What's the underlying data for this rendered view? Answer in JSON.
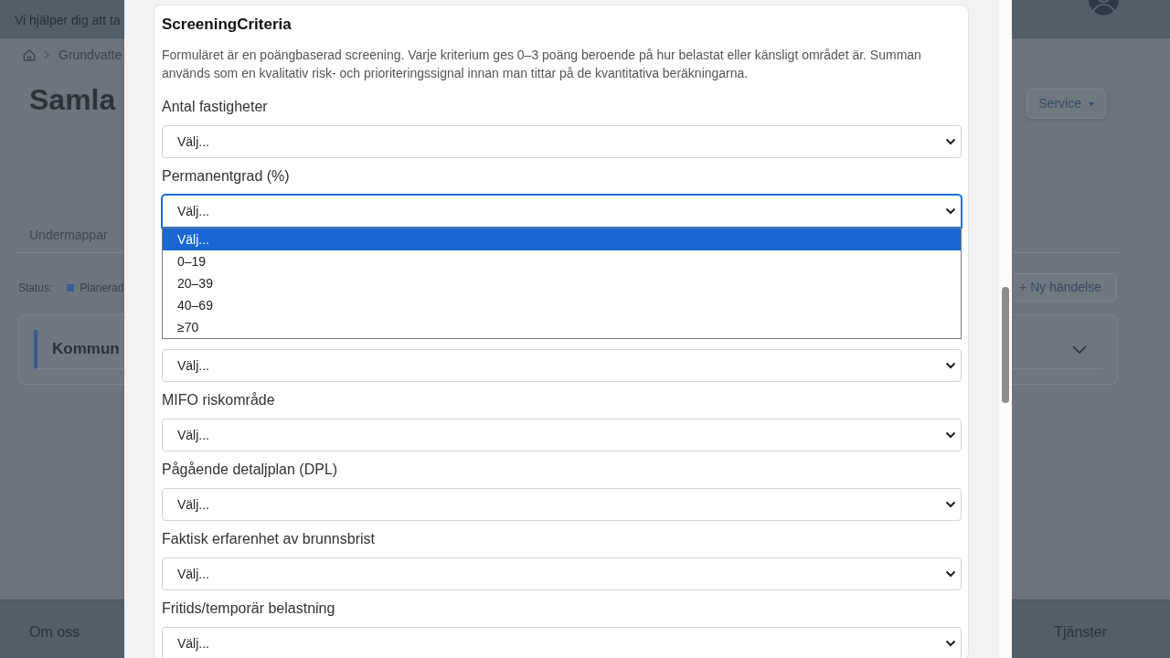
{
  "page": {
    "header": {
      "tagline": "Vi hjälper dig att ta"
    },
    "breadcrumb": {
      "items": [
        "Grundvatte"
      ]
    },
    "title": "Samla",
    "service_button": {
      "label": "Service"
    },
    "tabs": [
      {
        "label": "Undermappar",
        "selected": false
      }
    ],
    "status_bar": {
      "label": "Status:",
      "legend": [
        {
          "label": "Planerad",
          "color": "#3b5b98"
        }
      ]
    },
    "new_event_button": {
      "label": "+ Ny händelse"
    },
    "cards": [
      {
        "title": "Kommun",
        "expanded": false
      }
    ],
    "footer": {
      "links": [
        "Om oss",
        "Tjänster"
      ]
    }
  },
  "modal": {
    "title": "ScreeningCriteria",
    "description": "Formuläret är en poängbaserad screening. Varje kriterium ges 0–3 poäng beroende på hur belastat eller känsligt området är. Summan används som en kvalitativ risk- och prioriteringssignal innan man tittar på de kvantitativa beräkningarna.",
    "fields": [
      {
        "label": "Antal fastigheter",
        "value": "Välj...",
        "focused": false,
        "expanded": false
      },
      {
        "label": "Permanentgrad (%)",
        "value": "Välj...",
        "focused": true,
        "expanded": true,
        "options": [
          {
            "label": "Välj...",
            "selected": true
          },
          {
            "label": "0–19",
            "selected": false
          },
          {
            "label": "20–39",
            "selected": false
          },
          {
            "label": "40–69",
            "selected": false
          },
          {
            "label": "≥70",
            "selected": false
          }
        ]
      },
      {
        "value": "Välj...",
        "focused": false,
        "expanded": false
      },
      {
        "label": "MIFO riskområde",
        "value": "Välj...",
        "focused": false,
        "expanded": false
      },
      {
        "label": "Pågående detaljplan (DPL)",
        "value": "Välj...",
        "focused": false,
        "expanded": false
      },
      {
        "label": "Faktisk erfarenhet av brunnsbrist",
        "value": "Välj...",
        "focused": false,
        "expanded": false
      },
      {
        "label": "Fritids/temporär belastning",
        "value": "Välj...",
        "focused": false,
        "expanded": false
      }
    ]
  }
}
